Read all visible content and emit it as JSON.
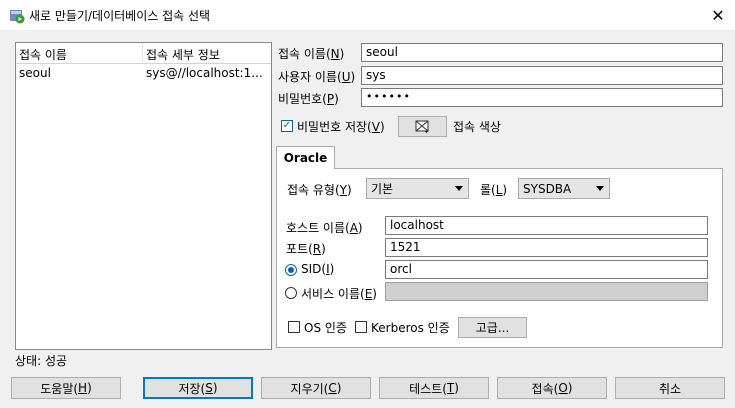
{
  "window": {
    "title": "새로 만들기/데이터베이스 접속 선택",
    "close_glyph": "✕"
  },
  "connections": {
    "columns": [
      "접속 이름",
      "접속 세부 정보"
    ],
    "rows": [
      {
        "name": "seoul",
        "details": "sys@//localhost:1..."
      }
    ]
  },
  "form": {
    "connection_name": {
      "label": "접속 이름(",
      "mnemonic": "N",
      "suffix": ")",
      "value": "seoul"
    },
    "username": {
      "label": "사용자 이름(",
      "mnemonic": "U",
      "suffix": ")",
      "value": "sys"
    },
    "password": {
      "label": "비밀번호(",
      "mnemonic": "P",
      "suffix": ")",
      "value": "••••••"
    },
    "save_password": {
      "label": "비밀번호 저장(",
      "mnemonic": "V",
      "suffix": ")",
      "checked": true
    },
    "connection_color": {
      "label": "접속 색상",
      "icon": "color-picker-icon"
    }
  },
  "tabs": [
    {
      "label": "Oracle",
      "active": true
    }
  ],
  "oracle": {
    "connection_type": {
      "label": "접속 유형(",
      "mnemonic": "Y",
      "suffix": ")",
      "value": "기본"
    },
    "role": {
      "label": "롤(",
      "mnemonic": "L",
      "suffix": ")",
      "value": "SYSDBA"
    },
    "hostname": {
      "label": "호스트 이름(",
      "mnemonic": "A",
      "suffix": ")",
      "value": "localhost"
    },
    "port": {
      "label": "포트(",
      "mnemonic": "R",
      "suffix": ")",
      "value": "1521"
    },
    "sid": {
      "label": "SID(",
      "mnemonic": "I",
      "suffix": ")",
      "value": "orcl",
      "selected": true
    },
    "service_name": {
      "label": "서비스 이름(",
      "mnemonic": "E",
      "suffix": ")",
      "value": "",
      "selected": false
    },
    "os_auth": {
      "label": "OS 인증",
      "checked": false
    },
    "kerberos_auth": {
      "label": "Kerberos 인증",
      "checked": false
    },
    "advanced_label": "고급..."
  },
  "status": {
    "text": "상태: 성공"
  },
  "buttons": {
    "help": {
      "label": "도움말(",
      "mnemonic": "H",
      "suffix": ")"
    },
    "save": {
      "label": "저장(",
      "mnemonic": "S",
      "suffix": ")"
    },
    "clear": {
      "label": "지우기(",
      "mnemonic": "C",
      "suffix": ")"
    },
    "test": {
      "label": "테스트(",
      "mnemonic": "T",
      "suffix": ")"
    },
    "connect": {
      "label": "접속(",
      "mnemonic": "O",
      "suffix": ")"
    },
    "cancel": {
      "label": "취소"
    }
  },
  "colors": {
    "accent": "#0078d7",
    "check": "#0a5fb4",
    "disabled_field": "#cfcfcf"
  }
}
